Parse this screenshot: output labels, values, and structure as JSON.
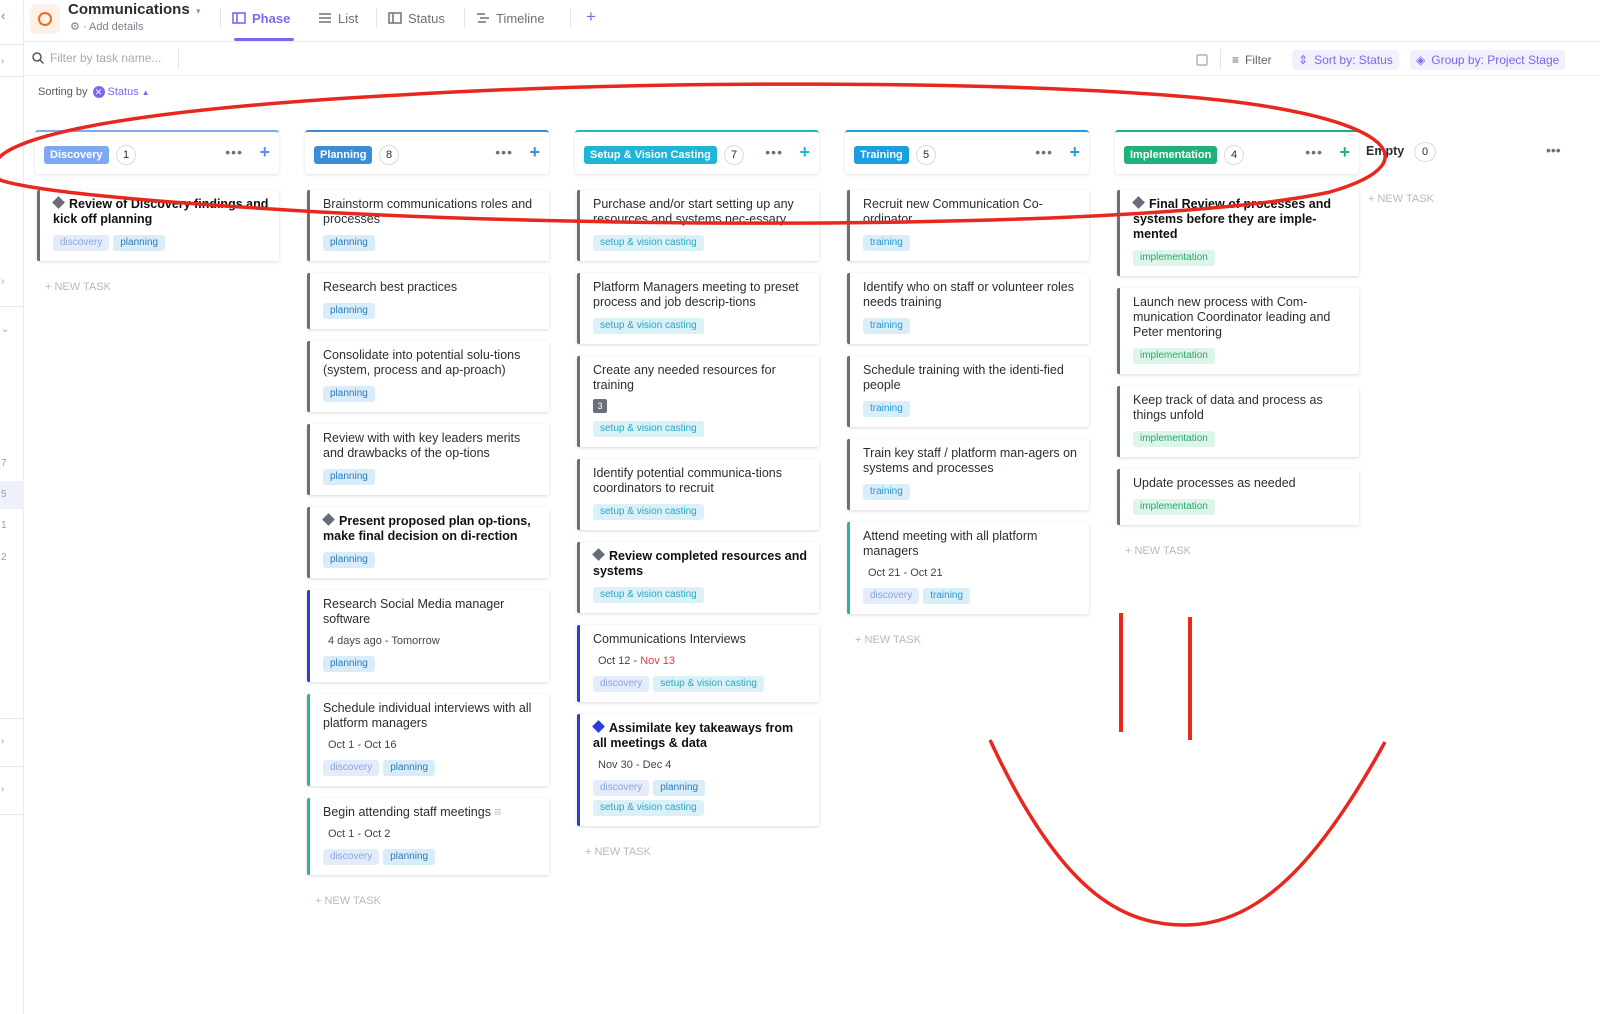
{
  "header": {
    "title": "Communications",
    "subtitle": "Add details",
    "tabs": [
      {
        "label": "Phase",
        "active": true
      },
      {
        "label": "List"
      },
      {
        "label": "Status"
      },
      {
        "label": "Timeline"
      }
    ]
  },
  "toolbar": {
    "search_placeholder": "Filter by task name...",
    "filter_label": "Filter",
    "sort_label": "Sort by: Status",
    "group_label": "Group by: Project Stage"
  },
  "sorting": {
    "prefix": "Sorting by",
    "field": "Status"
  },
  "rail": {
    "numbers": [
      "7",
      "5",
      "1",
      "2"
    ]
  },
  "columns": [
    {
      "name": "Discovery",
      "count": "1",
      "color": "#7fa8f4",
      "plus_color": "#5b8def",
      "cards": [
        {
          "title": "Review of Discovery findings and kick off planning",
          "milestone": true,
          "tags": [
            "discovery",
            "planning"
          ]
        }
      ],
      "new_task": "+ NEW TASK"
    },
    {
      "name": "Planning",
      "count": "8",
      "color": "#3b8ed6",
      "plus_color": "#3b8ed6",
      "cards": [
        {
          "title": "Brainstorm communications roles and processes",
          "tags": [
            "planning"
          ]
        },
        {
          "title": "Research best practices",
          "tags": [
            "planning"
          ]
        },
        {
          "title": "Consolidate into potential solu-tions (system, process and ap-proach)",
          "tags": [
            "planning"
          ]
        },
        {
          "title": "Review with with key leaders merits and drawbacks of the op-tions",
          "tags": [
            "planning"
          ]
        },
        {
          "title": "Present proposed plan op-tions, make final decision on di-rection",
          "milestone": true,
          "tags": [
            "planning"
          ]
        },
        {
          "title": "Research Social Media manager software",
          "dates": {
            "start": "4 days ago",
            "end": "Tomorrow"
          },
          "tags": [
            "planning"
          ]
        },
        {
          "title": "Schedule individual interviews with all platform managers",
          "dates": {
            "start": "Oct 1",
            "end": "Oct 16"
          },
          "tags": [
            "discovery",
            "planning"
          ]
        },
        {
          "title": "Begin attending staff meetings",
          "dates": {
            "start": "Oct 1",
            "end": "Oct 2"
          },
          "tags": [
            "discovery",
            "planning"
          ]
        }
      ],
      "new_task": "+ NEW TASK"
    },
    {
      "name": "Setup & Vision Casting",
      "count": "7",
      "color": "#1fb5d6",
      "plus_color": "#1fb5d6",
      "cards": [
        {
          "title": "Purchase and/or start setting up any resources and systems nec-essary",
          "tags": [
            "setup & vision casting"
          ]
        },
        {
          "title": "Platform Managers meeting to preset process and job descrip-tions",
          "tags": [
            "setup & vision casting"
          ]
        },
        {
          "title": "Create any needed resources for training",
          "subtasks": "3",
          "tags": [
            "setup & vision casting"
          ]
        },
        {
          "title": "Identify potential communica-tions coordinators to recruit",
          "tags": [
            "setup & vision casting"
          ]
        },
        {
          "title": "Review completed resources and systems",
          "milestone": true,
          "tags": [
            "setup & vision casting"
          ]
        },
        {
          "title": "Communications Interviews",
          "dates": {
            "start": "Oct 12",
            "end": "Nov 13"
          },
          "tags": [
            "discovery",
            "setup & vision casting"
          ]
        },
        {
          "title": "Assimilate key takeaways from all meetings & data",
          "milestone": true,
          "dates": {
            "start": "Nov 30",
            "end": "Dec 4"
          },
          "tags": [
            "discovery",
            "planning",
            "setup & vision casting"
          ]
        }
      ],
      "new_task": "+ NEW TASK"
    },
    {
      "name": "Training",
      "count": "5",
      "color": "#1a9fe0",
      "plus_color": "#1a9fe0",
      "cards": [
        {
          "title": "Recruit new Communication Co-ordinator",
          "tags": [
            "training"
          ]
        },
        {
          "title": "Identify who on staff or volunteer roles needs training",
          "tags": [
            "training"
          ]
        },
        {
          "title": "Schedule training with the identi-fied people",
          "tags": [
            "training"
          ]
        },
        {
          "title": "Train key staff / platform man-agers on systems and processes",
          "tags": [
            "training"
          ]
        },
        {
          "title": "Attend meeting with all platform managers",
          "dates": {
            "start": "Oct 21",
            "end": "Oct 21"
          },
          "tags": [
            "discovery",
            "training"
          ]
        }
      ],
      "new_task": "+ NEW TASK"
    },
    {
      "name": "Implementation",
      "count": "4",
      "color": "#1eb27a",
      "plus_color": "#1eb27a",
      "cards": [
        {
          "title": "Final Review of processes and systems before they are imple-mented",
          "milestone": true,
          "tags": [
            "implementation"
          ]
        },
        {
          "title": "Launch new process with Com-munication Coordinator leading and Peter mentoring",
          "tags": [
            "implementation"
          ]
        },
        {
          "title": "Keep track of data and process as things unfold",
          "tags": [
            "implementation"
          ]
        },
        {
          "title": "Update processes as needed",
          "tags": [
            "implementation"
          ]
        }
      ],
      "new_task": "+ NEW TASK"
    }
  ],
  "empty_column": {
    "name": "Empty",
    "count": "0",
    "new_task": "+ NEW TASK"
  },
  "annotation_color": "#e8281e"
}
